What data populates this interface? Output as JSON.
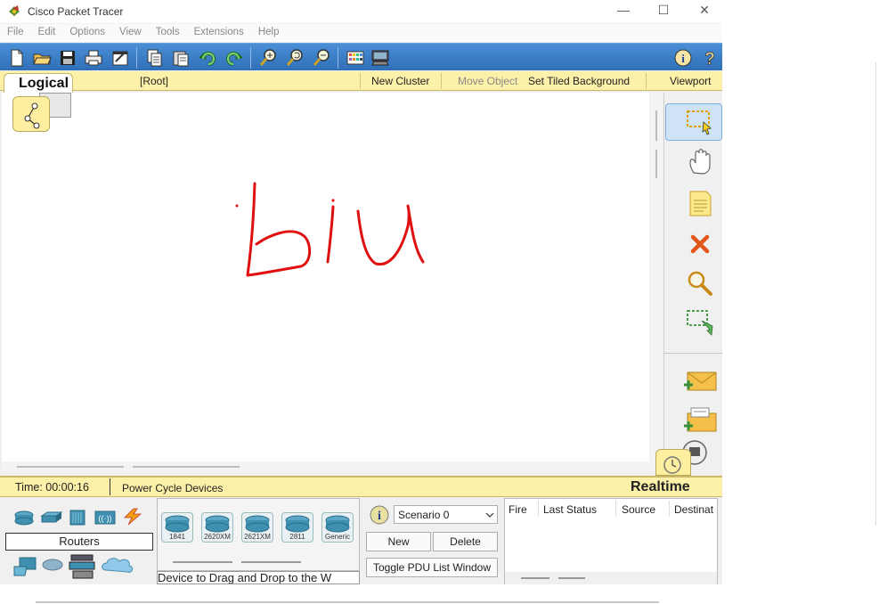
{
  "window": {
    "title": "Cisco Packet Tracer"
  },
  "window_controls": {
    "minimize": "—",
    "maximize": "☐",
    "close": "✕"
  },
  "menu": [
    "File",
    "Edit",
    "Options",
    "View",
    "Tools",
    "Extensions",
    "Help"
  ],
  "logical_bar": {
    "tab": "Logical",
    "root": "[Root]",
    "new_cluster": "New Cluster",
    "move_object": "Move Object",
    "set_tiled_background": "Set Tiled Background",
    "viewport": "Viewport"
  },
  "workspace": {
    "drawing_text": "biu"
  },
  "realtime_bar": {
    "time": "Time: 00:00:16",
    "power_cycle": "Power Cycle Devices",
    "mode": "Realtime"
  },
  "device_panel": {
    "category_label": "Routers",
    "devices": [
      "1841",
      "2620XM",
      "2621XM",
      "2811",
      "Generic"
    ],
    "hint": "Device to Drag and Drop to the W"
  },
  "scenario": {
    "selected": "Scenario 0",
    "new_label": "New",
    "delete_label": "Delete",
    "toggle_label": "Toggle PDU List Window"
  },
  "pdu_table": {
    "columns": [
      "Fire",
      "Last Status",
      "Source",
      "Destinat"
    ]
  },
  "colors": {
    "toolbar_blue": "#2f6fb8",
    "yellow_bar": "#fdf0a8",
    "ink_red": "#e01010"
  }
}
